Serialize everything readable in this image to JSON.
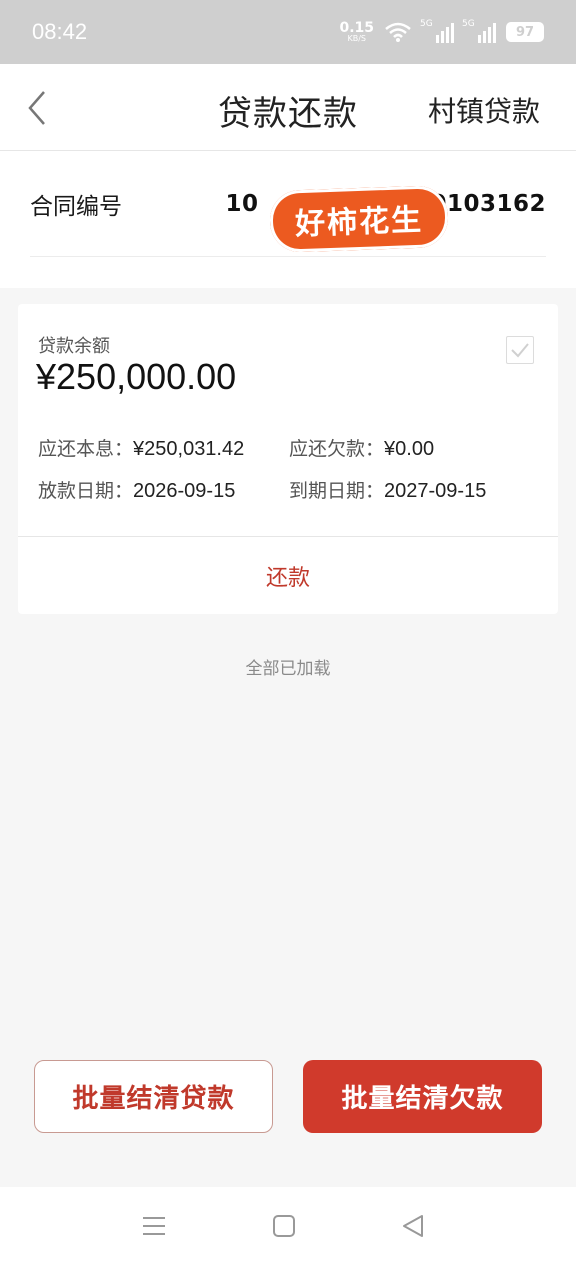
{
  "status_bar": {
    "time": "08:42",
    "net_speed_value": "0.15",
    "net_speed_unit": "KB/S",
    "signal_1_label": "5G",
    "signal_2_label": "5G",
    "battery": "97"
  },
  "header": {
    "title": "贷款还款",
    "right_link": "村镇贷款"
  },
  "contract": {
    "label": "合同编号",
    "number_prefix": "10",
    "number_suffix": "0103162",
    "sticker_text": "好柿花生"
  },
  "loan": {
    "balance_label": "贷款余额",
    "balance_value": "¥250,000.00",
    "principal_interest_label": "应还本息：",
    "principal_interest_value": "¥250,031.42",
    "arrears_label": "应还欠款：",
    "arrears_value": "¥0.00",
    "disburse_date_label": "放款日期：",
    "disburse_date_value": "2026-09-15",
    "due_date_label": "到期日期：",
    "due_date_value": "2027-09-15",
    "repay_label": "还款"
  },
  "list_footer": "全部已加载",
  "actions": {
    "settle_loans": "批量结清贷款",
    "settle_arrears": "批量结清欠款"
  },
  "colors": {
    "accent": "#d03a2c",
    "sticker": "#ec5a20"
  }
}
